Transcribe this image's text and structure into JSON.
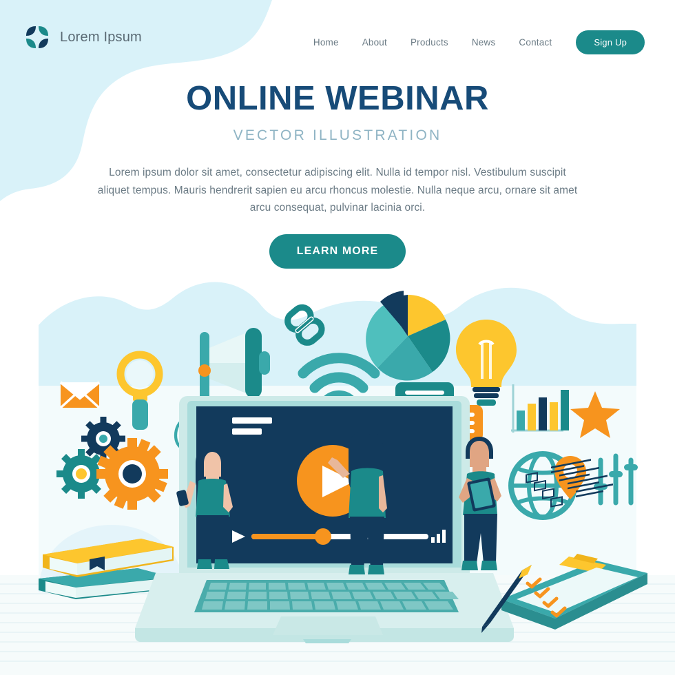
{
  "header": {
    "brand_name": "Lorem Ipsum",
    "logo_icon": "four-petal-logo-icon",
    "nav_items": [
      {
        "label": "Home"
      },
      {
        "label": "About"
      },
      {
        "label": "Products"
      },
      {
        "label": "News"
      },
      {
        "label": "Contact"
      }
    ],
    "signup_label": "Sign Up"
  },
  "hero": {
    "title": "ONLINE WEBINAR",
    "subtitle": "VECTOR  ILLUSTRATION",
    "body": "Lorem ipsum dolor sit amet, consectetur adipiscing elit. Nulla id tempor nisl. Vestibulum suscipit aliquet tempus. Mauris hendrerit sapien eu arcu rhoncus molestie. Nulla neque arcu, ornare sit amet arcu consequat, pulvinar lacinia orci.",
    "cta_label": "LEARN MORE"
  },
  "illustration": {
    "name": "online-webinar-illustration",
    "laptop": {
      "name": "laptop-device",
      "screen_name": "video-player-screen",
      "play_button": "play-button-icon",
      "progress_percent": 42,
      "volume_icon": "volume-bars-icon",
      "play_small_icon": "play-small-icon"
    },
    "icons": [
      {
        "name": "envelope-icon",
        "label": "Email"
      },
      {
        "name": "magnifier-icon",
        "label": "Search"
      },
      {
        "name": "at-sign-icon",
        "label": "@"
      },
      {
        "name": "gears-icon",
        "label": "Settings"
      },
      {
        "name": "megaphone-icon",
        "label": "Announcement"
      },
      {
        "name": "chain-link-icon",
        "label": "Link"
      },
      {
        "name": "wifi-icon",
        "label": "WiFi"
      },
      {
        "name": "pie-chart-icon",
        "label": "Pie Chart"
      },
      {
        "name": "lightbulb-icon",
        "label": "Idea"
      },
      {
        "name": "chat-bubble-teal-icon",
        "label": "Message"
      },
      {
        "name": "chat-bubble-orange-icon",
        "label": "Reply"
      },
      {
        "name": "bar-chart-icon",
        "label": "Statistics"
      },
      {
        "name": "star-icon",
        "label": "Favorite"
      },
      {
        "name": "globe-pin-icon",
        "label": "Global"
      },
      {
        "name": "sliders-icon",
        "label": "Controls"
      },
      {
        "name": "books-icon",
        "label": "Books"
      },
      {
        "name": "clipboard-checklist-icon",
        "label": "Checklist"
      },
      {
        "name": "pencil-icon",
        "label": "Pencil"
      }
    ],
    "people": [
      {
        "name": "person-woman-phone"
      },
      {
        "name": "person-woman-presenter"
      },
      {
        "name": "person-man-tablet"
      }
    ]
  },
  "colors": {
    "navy": "#174b78",
    "dark_navy": "#123a5c",
    "teal": "#1b8a8a",
    "teal_light": "#3aa9ab",
    "teal_pale": "#b9e4e2",
    "orange": "#f7941e",
    "yellow": "#fdc62e",
    "cyan_bg": "#d9f2f9",
    "mint": "#cdeae8",
    "text_gray": "#6b7b85",
    "sub_blue": "#8fb4c4"
  }
}
